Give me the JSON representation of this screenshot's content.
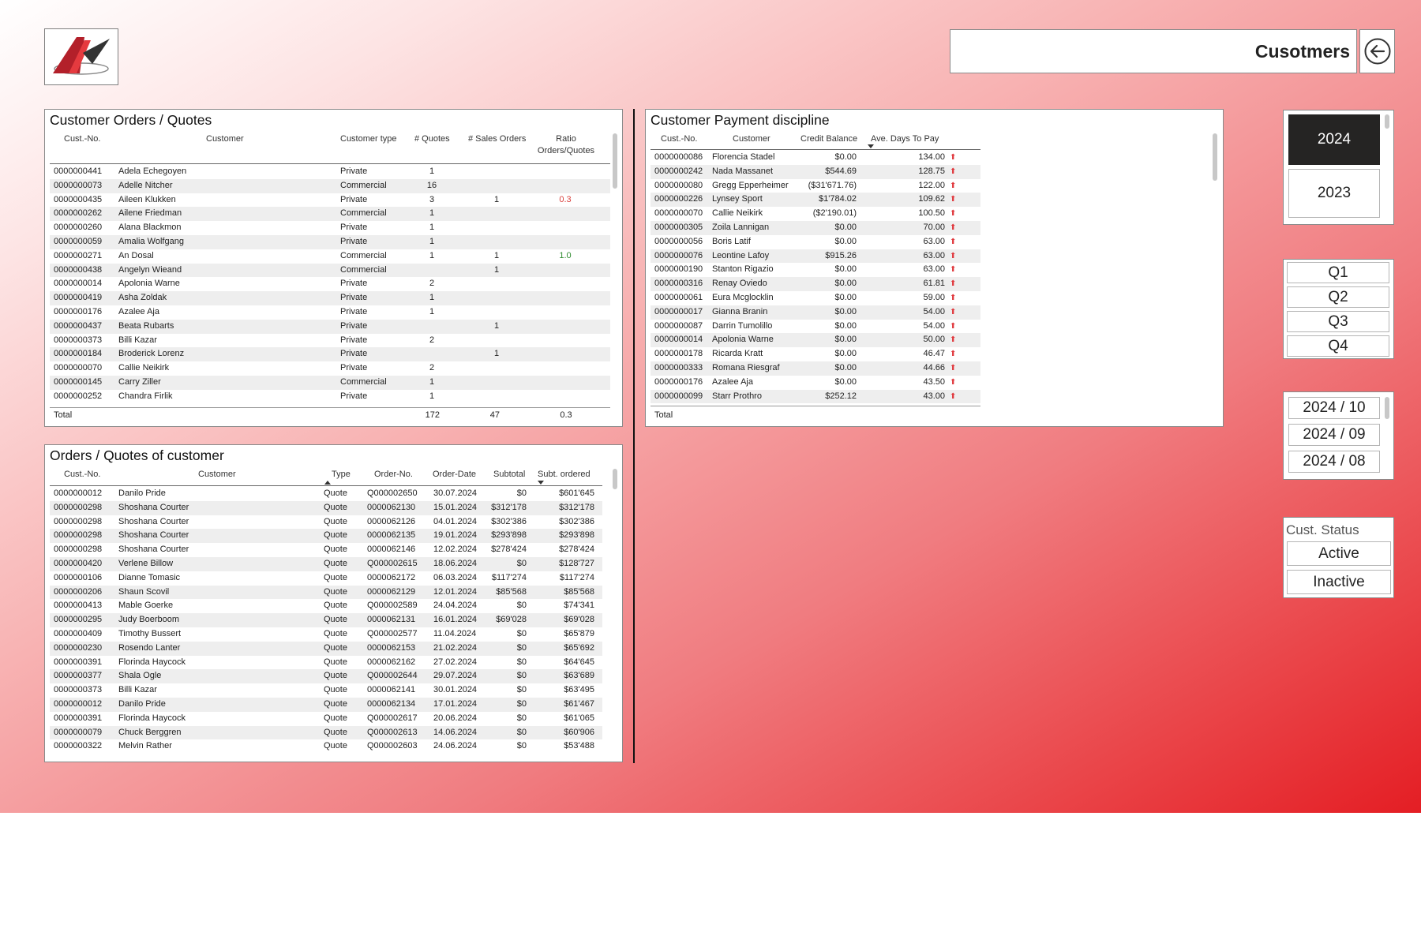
{
  "header": {
    "title": "Cusotmers",
    "back_icon": "arrow-left-circle-icon",
    "logo_icon": "company-logo-icon"
  },
  "colors": {
    "accent": "#e41e24",
    "selected": "#252423",
    "negative_ratio": "#d9403c",
    "positive_ratio": "#2e8b2e",
    "arrow": "#e0393e"
  },
  "orders_quotes": {
    "title": "Customer Orders / Quotes",
    "headers": {
      "cust_no": "Cust.-No.",
      "customer": "Customer",
      "type": "Customer type",
      "quotes": "# Quotes",
      "sales": "# Sales Orders",
      "ratio1": "Ratio",
      "ratio2": "Orders/Quotes"
    },
    "rows": [
      {
        "no": "0000000441",
        "name": "Adela Echegoyen",
        "type": "Private",
        "quotes": "1",
        "sales": "",
        "ratio": ""
      },
      {
        "no": "0000000073",
        "name": "Adelle Nitcher",
        "type": "Commercial",
        "quotes": "16",
        "sales": "",
        "ratio": ""
      },
      {
        "no": "0000000435",
        "name": "Aileen Klukken",
        "type": "Private",
        "quotes": "3",
        "sales": "1",
        "ratio": "0.3"
      },
      {
        "no": "0000000262",
        "name": "Ailene Friedman",
        "type": "Commercial",
        "quotes": "1",
        "sales": "",
        "ratio": ""
      },
      {
        "no": "0000000260",
        "name": "Alana Blackmon",
        "type": "Private",
        "quotes": "1",
        "sales": "",
        "ratio": ""
      },
      {
        "no": "0000000059",
        "name": "Amalia Wolfgang",
        "type": "Private",
        "quotes": "1",
        "sales": "",
        "ratio": ""
      },
      {
        "no": "0000000271",
        "name": "An Dosal",
        "type": "Commercial",
        "quotes": "1",
        "sales": "1",
        "ratio": "1.0"
      },
      {
        "no": "0000000438",
        "name": "Angelyn Wieand",
        "type": "Commercial",
        "quotes": "",
        "sales": "1",
        "ratio": ""
      },
      {
        "no": "0000000014",
        "name": "Apolonia Warne",
        "type": "Private",
        "quotes": "2",
        "sales": "",
        "ratio": ""
      },
      {
        "no": "0000000419",
        "name": "Asha Zoldak",
        "type": "Private",
        "quotes": "1",
        "sales": "",
        "ratio": ""
      },
      {
        "no": "0000000176",
        "name": "Azalee Aja",
        "type": "Private",
        "quotes": "1",
        "sales": "",
        "ratio": ""
      },
      {
        "no": "0000000437",
        "name": "Beata Rubarts",
        "type": "Private",
        "quotes": "",
        "sales": "1",
        "ratio": ""
      },
      {
        "no": "0000000373",
        "name": "Billi Kazar",
        "type": "Private",
        "quotes": "2",
        "sales": "",
        "ratio": ""
      },
      {
        "no": "0000000184",
        "name": "Broderick Lorenz",
        "type": "Private",
        "quotes": "",
        "sales": "1",
        "ratio": ""
      },
      {
        "no": "0000000070",
        "name": "Callie Neikirk",
        "type": "Private",
        "quotes": "2",
        "sales": "",
        "ratio": ""
      },
      {
        "no": "0000000145",
        "name": "Carry Ziller",
        "type": "Commercial",
        "quotes": "1",
        "sales": "",
        "ratio": ""
      },
      {
        "no": "0000000252",
        "name": "Chandra Firlik",
        "type": "Private",
        "quotes": "1",
        "sales": "",
        "ratio": ""
      }
    ],
    "total": {
      "label": "Total",
      "quotes": "172",
      "sales": "47",
      "ratio": "0.3"
    }
  },
  "payment": {
    "title": "Customer Payment discipline",
    "headers": {
      "cust_no": "Cust.-No.",
      "customer": "Customer",
      "credit": "Credit Balance",
      "days": "Ave. Days To Pay"
    },
    "rows": [
      {
        "no": "0000000086",
        "name": "Florencia Stadel",
        "credit": "$0.00",
        "days": "134.00"
      },
      {
        "no": "0000000242",
        "name": "Nada Massanet",
        "credit": "$544.69",
        "days": "128.75"
      },
      {
        "no": "0000000080",
        "name": "Gregg Epperheimer",
        "credit": "($31'671.76)",
        "days": "122.00"
      },
      {
        "no": "0000000226",
        "name": "Lynsey Sport",
        "credit": "$1'784.02",
        "days": "109.62"
      },
      {
        "no": "0000000070",
        "name": "Callie Neikirk",
        "credit": "($2'190.01)",
        "days": "100.50"
      },
      {
        "no": "0000000305",
        "name": "Zoila Lannigan",
        "credit": "$0.00",
        "days": "70.00"
      },
      {
        "no": "0000000056",
        "name": "Boris Latif",
        "credit": "$0.00",
        "days": "63.00"
      },
      {
        "no": "0000000076",
        "name": "Leontine Lafoy",
        "credit": "$915.26",
        "days": "63.00"
      },
      {
        "no": "0000000190",
        "name": "Stanton Rigazio",
        "credit": "$0.00",
        "days": "63.00"
      },
      {
        "no": "0000000316",
        "name": "Renay Oviedo",
        "credit": "$0.00",
        "days": "61.81"
      },
      {
        "no": "0000000061",
        "name": "Eura Mcglocklin",
        "credit": "$0.00",
        "days": "59.00"
      },
      {
        "no": "0000000017",
        "name": "Gianna Branin",
        "credit": "$0.00",
        "days": "54.00"
      },
      {
        "no": "0000000087",
        "name": "Darrin Tumolillo",
        "credit": "$0.00",
        "days": "54.00"
      },
      {
        "no": "0000000014",
        "name": "Apolonia Warne",
        "credit": "$0.00",
        "days": "50.00"
      },
      {
        "no": "0000000178",
        "name": "Ricarda Kratt",
        "credit": "$0.00",
        "days": "46.47"
      },
      {
        "no": "0000000333",
        "name": "Romana Riesgraf",
        "credit": "$0.00",
        "days": "44.66"
      },
      {
        "no": "0000000176",
        "name": "Azalee Aja",
        "credit": "$0.00",
        "days": "43.50"
      },
      {
        "no": "0000000099",
        "name": "Starr Prothro",
        "credit": "$252.12",
        "days": "43.00"
      }
    ],
    "total": {
      "label": "Total"
    }
  },
  "customer_orders": {
    "title": "Orders / Quotes of customer",
    "headers": {
      "cust_no": "Cust.-No.",
      "customer": "Customer",
      "type": "Type",
      "order_no": "Order-No.",
      "order_date": "Order-Date",
      "subtotal": "Subtotal",
      "ordered": "Subt. ordered"
    },
    "rows": [
      {
        "no": "0000000012",
        "name": "Danilo Pride",
        "type": "Quote",
        "order": "Q000002650",
        "date": "30.07.2024",
        "sub": "$0",
        "ordered": "$601'645"
      },
      {
        "no": "0000000298",
        "name": "Shoshana Courter",
        "type": "Quote",
        "order": "0000062130",
        "date": "15.01.2024",
        "sub": "$312'178",
        "ordered": "$312'178"
      },
      {
        "no": "0000000298",
        "name": "Shoshana Courter",
        "type": "Quote",
        "order": "0000062126",
        "date": "04.01.2024",
        "sub": "$302'386",
        "ordered": "$302'386"
      },
      {
        "no": "0000000298",
        "name": "Shoshana Courter",
        "type": "Quote",
        "order": "0000062135",
        "date": "19.01.2024",
        "sub": "$293'898",
        "ordered": "$293'898"
      },
      {
        "no": "0000000298",
        "name": "Shoshana Courter",
        "type": "Quote",
        "order": "0000062146",
        "date": "12.02.2024",
        "sub": "$278'424",
        "ordered": "$278'424"
      },
      {
        "no": "0000000420",
        "name": "Verlene Billow",
        "type": "Quote",
        "order": "Q000002615",
        "date": "18.06.2024",
        "sub": "$0",
        "ordered": "$128'727"
      },
      {
        "no": "0000000106",
        "name": "Dianne Tomasic",
        "type": "Quote",
        "order": "0000062172",
        "date": "06.03.2024",
        "sub": "$117'274",
        "ordered": "$117'274"
      },
      {
        "no": "0000000206",
        "name": "Shaun Scovil",
        "type": "Quote",
        "order": "0000062129",
        "date": "12.01.2024",
        "sub": "$85'568",
        "ordered": "$85'568"
      },
      {
        "no": "0000000413",
        "name": "Mable Goerke",
        "type": "Quote",
        "order": "Q000002589",
        "date": "24.04.2024",
        "sub": "$0",
        "ordered": "$74'341"
      },
      {
        "no": "0000000295",
        "name": "Judy Boerboom",
        "type": "Quote",
        "order": "0000062131",
        "date": "16.01.2024",
        "sub": "$69'028",
        "ordered": "$69'028"
      },
      {
        "no": "0000000409",
        "name": "Timothy Bussert",
        "type": "Quote",
        "order": "Q000002577",
        "date": "11.04.2024",
        "sub": "$0",
        "ordered": "$65'879"
      },
      {
        "no": "0000000230",
        "name": "Rosendo Lanter",
        "type": "Quote",
        "order": "0000062153",
        "date": "21.02.2024",
        "sub": "$0",
        "ordered": "$65'692"
      },
      {
        "no": "0000000391",
        "name": "Florinda Haycock",
        "type": "Quote",
        "order": "0000062162",
        "date": "27.02.2024",
        "sub": "$0",
        "ordered": "$64'645"
      },
      {
        "no": "0000000377",
        "name": "Shala Ogle",
        "type": "Quote",
        "order": "Q000002644",
        "date": "29.07.2024",
        "sub": "$0",
        "ordered": "$63'689"
      },
      {
        "no": "0000000373",
        "name": "Billi Kazar",
        "type": "Quote",
        "order": "0000062141",
        "date": "30.01.2024",
        "sub": "$0",
        "ordered": "$63'495"
      },
      {
        "no": "0000000012",
        "name": "Danilo Pride",
        "type": "Quote",
        "order": "0000062134",
        "date": "17.01.2024",
        "sub": "$0",
        "ordered": "$61'467"
      },
      {
        "no": "0000000391",
        "name": "Florinda Haycock",
        "type": "Quote",
        "order": "Q000002617",
        "date": "20.06.2024",
        "sub": "$0",
        "ordered": "$61'065"
      },
      {
        "no": "0000000079",
        "name": "Chuck Berggren",
        "type": "Quote",
        "order": "Q000002613",
        "date": "14.06.2024",
        "sub": "$0",
        "ordered": "$60'906"
      },
      {
        "no": "0000000322",
        "name": "Melvin Rather",
        "type": "Quote",
        "order": "Q000002603",
        "date": "24.06.2024",
        "sub": "$0",
        "ordered": "$53'488"
      }
    ]
  },
  "year_slicer": {
    "items": [
      "2024",
      "2023"
    ],
    "selected": "2024"
  },
  "quarter_slicer": {
    "items": [
      "Q1",
      "Q2",
      "Q3",
      "Q4"
    ]
  },
  "month_slicer": {
    "items": [
      "2024 / 10",
      "2024 / 09",
      "2024 / 08"
    ]
  },
  "status_slicer": {
    "title": "Cust. Status",
    "items": [
      "Active",
      "Inactive"
    ]
  }
}
